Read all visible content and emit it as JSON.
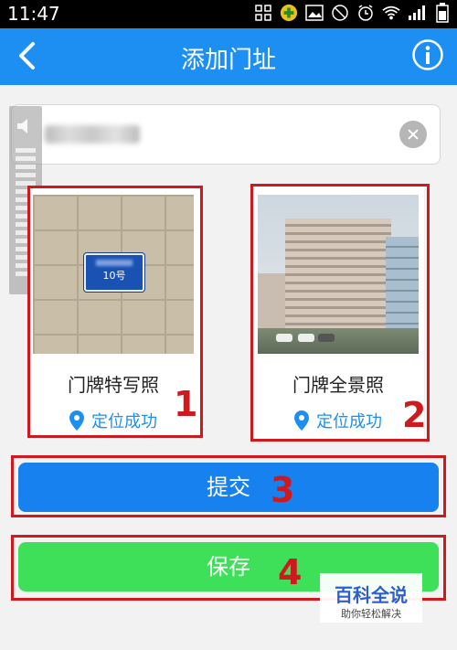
{
  "status_bar": {
    "time": "11:47",
    "icons": [
      "grid-icon",
      "app-badge-icon",
      "image-icon",
      "no-signal-icon",
      "alarm-icon",
      "wifi-icon",
      "signal-icon",
      "battery-icon"
    ]
  },
  "header": {
    "title": "添加门址",
    "back_icon": "chevron-left-icon",
    "info_icon": "info-icon",
    "color": "#1d8ff2"
  },
  "address_input": {
    "value": "",
    "clear_icon": "clear-icon"
  },
  "cards": [
    {
      "label": "门牌特写照",
      "location_status": "定位成功",
      "plate_number": "10号",
      "annotation_number": "1"
    },
    {
      "label": "门牌全景照",
      "location_status": "定位成功",
      "annotation_number": "2"
    }
  ],
  "buttons": {
    "submit_label": "提交",
    "submit_annotation": "3",
    "save_label": "保存",
    "save_annotation": "4"
  },
  "watermark": {
    "title": "百科全说",
    "subtitle": "助你轻松解决"
  },
  "colors": {
    "accent_blue": "#1d8ff2",
    "submit_blue": "#1781f0",
    "save_green": "#3ee05a",
    "annotation_red": "#d0191f"
  }
}
